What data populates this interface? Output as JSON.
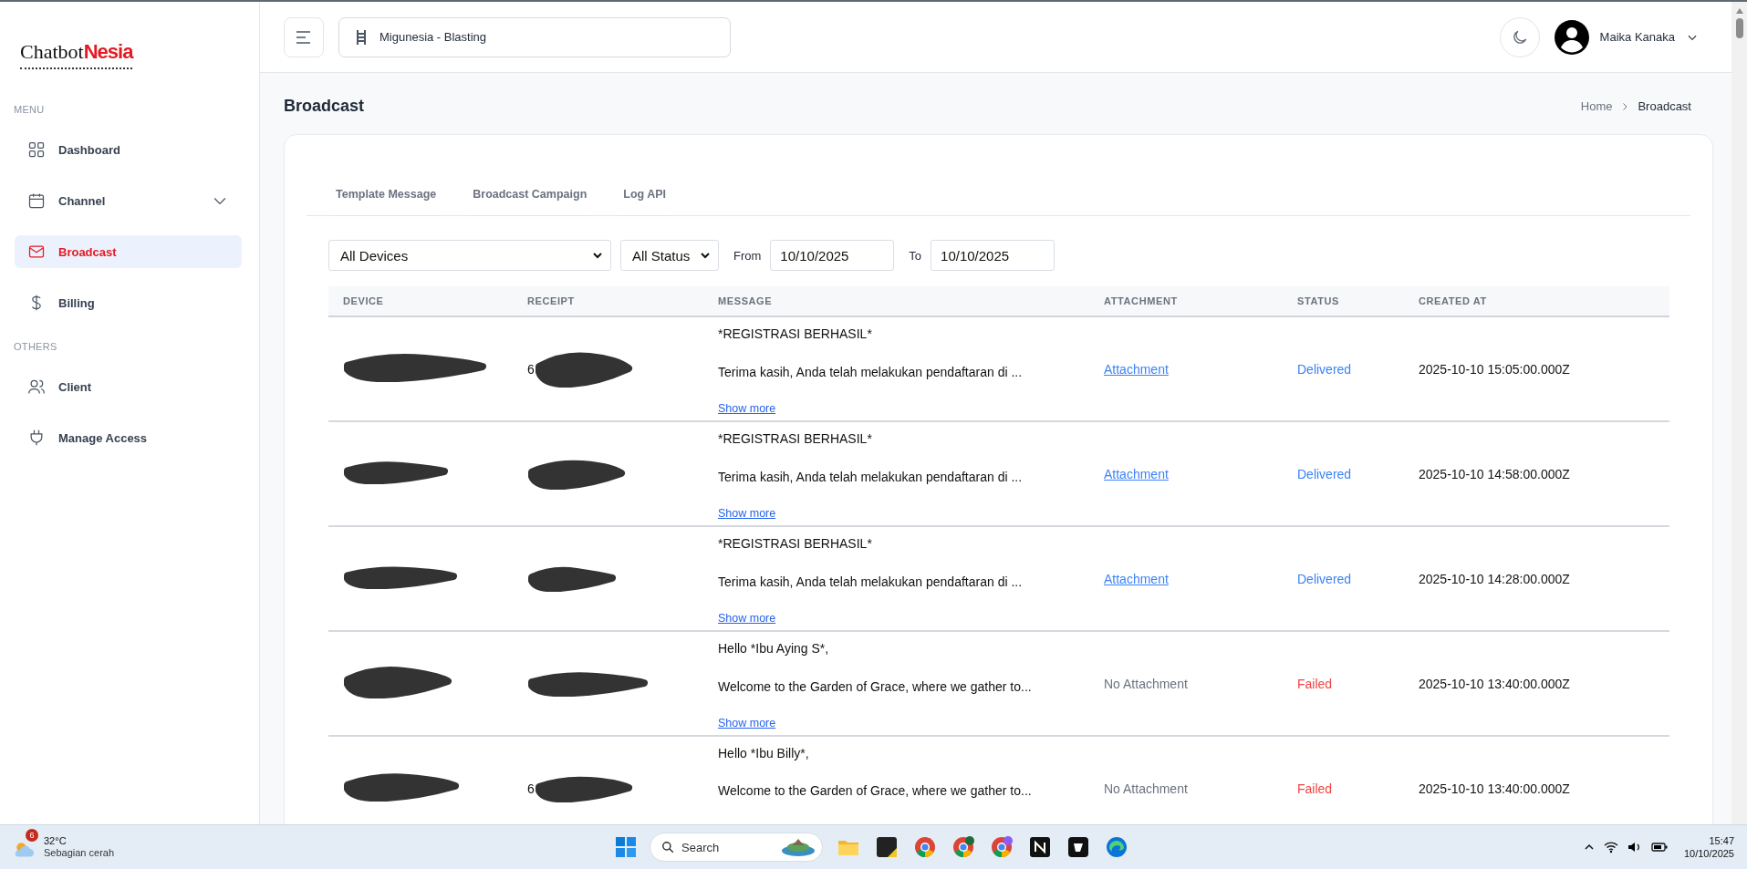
{
  "logo": {
    "part_1": "Chatbot",
    "part_2": "Nesia"
  },
  "sidebar": {
    "sections": [
      {
        "heading": "MENU",
        "items": [
          {
            "label": "Dashboard",
            "selected": false,
            "expandable": false
          },
          {
            "label": "Channel",
            "selected": false,
            "expandable": true
          },
          {
            "label": "Broadcast",
            "selected": true,
            "expandable": false
          },
          {
            "label": "Billing",
            "selected": false,
            "expandable": false
          }
        ]
      },
      {
        "heading": "OTHERS",
        "items": [
          {
            "label": "Client",
            "selected": false,
            "expandable": false
          },
          {
            "label": "Manage Access",
            "selected": false,
            "expandable": false
          }
        ]
      }
    ]
  },
  "header": {
    "project": "Migunesia - Blasting",
    "user": "Maika Kanaka"
  },
  "page": {
    "title": "Broadcast",
    "breadcrumb": [
      "Home",
      "Broadcast"
    ]
  },
  "tabs": [
    {
      "label": "Template Message",
      "selected": false
    },
    {
      "label": "Broadcast Campaign",
      "selected": false
    },
    {
      "label": "Log API",
      "selected": false
    }
  ],
  "filters": {
    "device": "All Devices",
    "status": "All Status",
    "from_label": "From",
    "from": "10/10/2025",
    "to_label": "To",
    "to": "10/10/2025"
  },
  "table": {
    "columns": [
      "DEVICE",
      "RECEIPT",
      "MESSAGE",
      "ATTACHMENT",
      "STATUS",
      "CREATED AT"
    ],
    "rows": [
      {
        "receipt": "6",
        "message_title": "*REGISTRASI BERHASIL*",
        "message_body": "Terima kasih, Anda telah melakukan pendaftaran di ...",
        "show_more": "Show more",
        "attachment": "Attachment",
        "has_attachment": true,
        "status": "Delivered",
        "delivered": true,
        "created_at": "2025-10-10 15:05:00.000Z"
      },
      {
        "message_title": "*REGISTRASI BERHASIL*",
        "message_body": "Terima kasih, Anda telah melakukan pendaftaran di ...",
        "show_more": "Show more",
        "attachment": "Attachment",
        "has_attachment": true,
        "status": "Delivered",
        "delivered": true,
        "created_at": "2025-10-10 14:58:00.000Z"
      },
      {
        "message_title": "*REGISTRASI BERHASIL*",
        "message_body": "Terima kasih, Anda telah melakukan pendaftaran di ...",
        "show_more": "Show more",
        "attachment": "Attachment",
        "has_attachment": true,
        "status": "Delivered",
        "delivered": true,
        "created_at": "2025-10-10 14:28:00.000Z"
      },
      {
        "message_title": "Hello *Ibu Aying S*,",
        "message_body": "Welcome to the Garden of Grace, where we gather to...",
        "show_more": "Show more",
        "attachment": "No Attachment",
        "has_attachment": false,
        "status": "Failed",
        "delivered": false,
        "created_at": "2025-10-10 13:40:00.000Z"
      },
      {
        "receipt": "6",
        "message_title": "Hello *Ibu Billy*,",
        "message_body": "Welcome to the Garden of Grace, where we gather to...",
        "attachment": "No Attachment",
        "has_attachment": false,
        "status": "Failed",
        "delivered": false,
        "created_at": "2025-10-10 13:40:00.000Z"
      }
    ]
  },
  "taskbar": {
    "weather_badge": "6",
    "temperature": "32°C",
    "weather": "Sebagian cerah",
    "search_placeholder": "Search",
    "time": "15:47",
    "date": "10/10/2025"
  }
}
